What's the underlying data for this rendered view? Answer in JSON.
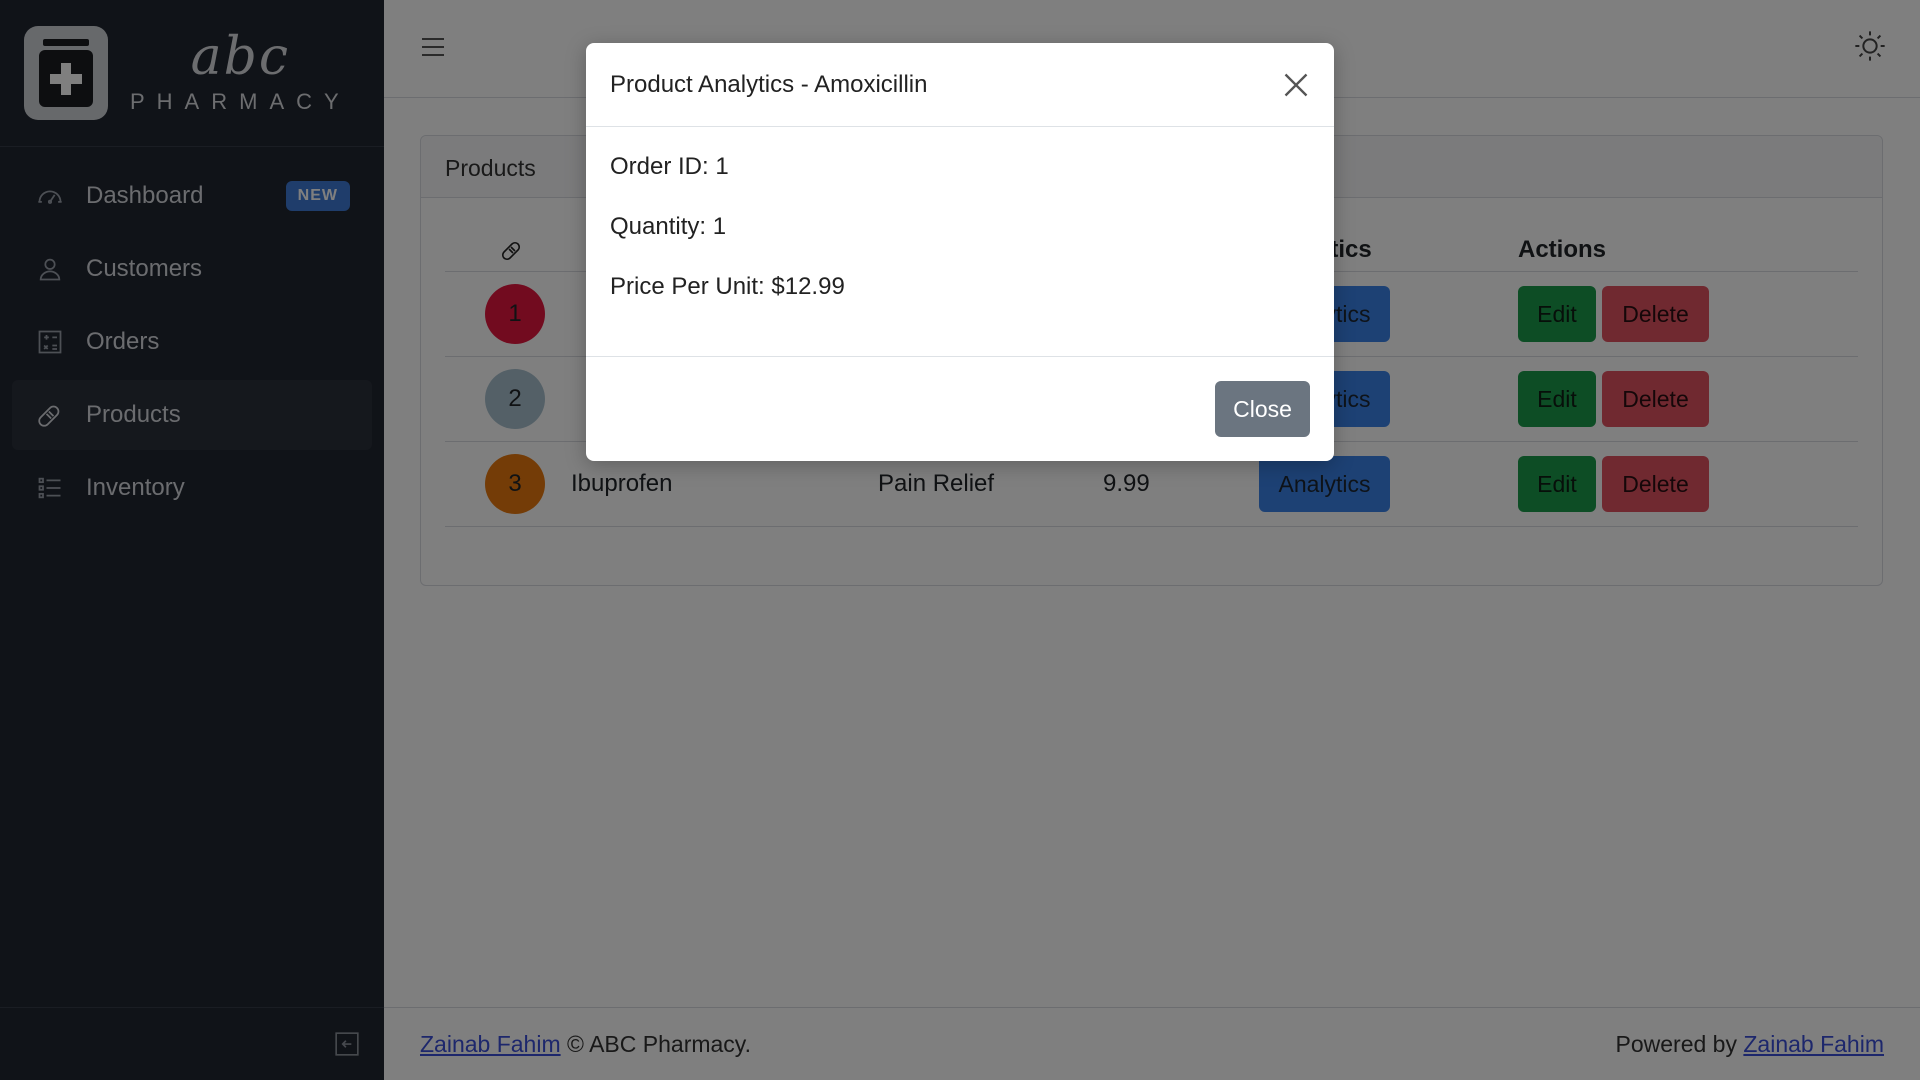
{
  "brand": {
    "top": "abc",
    "bottom": "PHARMACY"
  },
  "sidebar": {
    "items": [
      {
        "label": "Dashboard",
        "icon": "speedometer-icon",
        "badge": "NEW"
      },
      {
        "label": "Customers",
        "icon": "user-icon"
      },
      {
        "label": "Orders",
        "icon": "calculator-icon"
      },
      {
        "label": "Products",
        "icon": "bandage-icon",
        "active": true
      },
      {
        "label": "Inventory",
        "icon": "list-icon"
      }
    ]
  },
  "card": {
    "title": "Products",
    "columns": {
      "icon": "bandage-icon",
      "analytics": "Analytics",
      "actions": "Actions"
    },
    "rows": [
      {
        "id": "1",
        "name": "",
        "category": "",
        "price": "",
        "color": "#e4173f"
      },
      {
        "id": "2",
        "name": "",
        "category": "",
        "price": "",
        "color": "#a9c1cf"
      },
      {
        "id": "3",
        "name": "Ibuprofen",
        "category": "Pain Relief",
        "price": "9.99",
        "color": "#e8790f"
      }
    ],
    "buttons": {
      "analytics": "Analytics",
      "edit": "Edit",
      "delete": "Delete"
    }
  },
  "footer": {
    "author_link": "Zainab Fahim",
    "copyright": "© ABC Pharmacy.",
    "powered_prefix": "Powered by",
    "powered_link": "Zainab Fahim"
  },
  "modal": {
    "title": "Product Analytics - Amoxicillin",
    "order_id": "Order ID: 1",
    "quantity": "Quantity: 1",
    "price": "Price Per Unit: $12.99",
    "close_label": "Close"
  },
  "colors": {
    "sidebar_bg": "#212631",
    "accent_blue": "#3b82e8",
    "success": "#1b9a4a",
    "danger": "#e05260",
    "badge": "#3e7ad6"
  }
}
